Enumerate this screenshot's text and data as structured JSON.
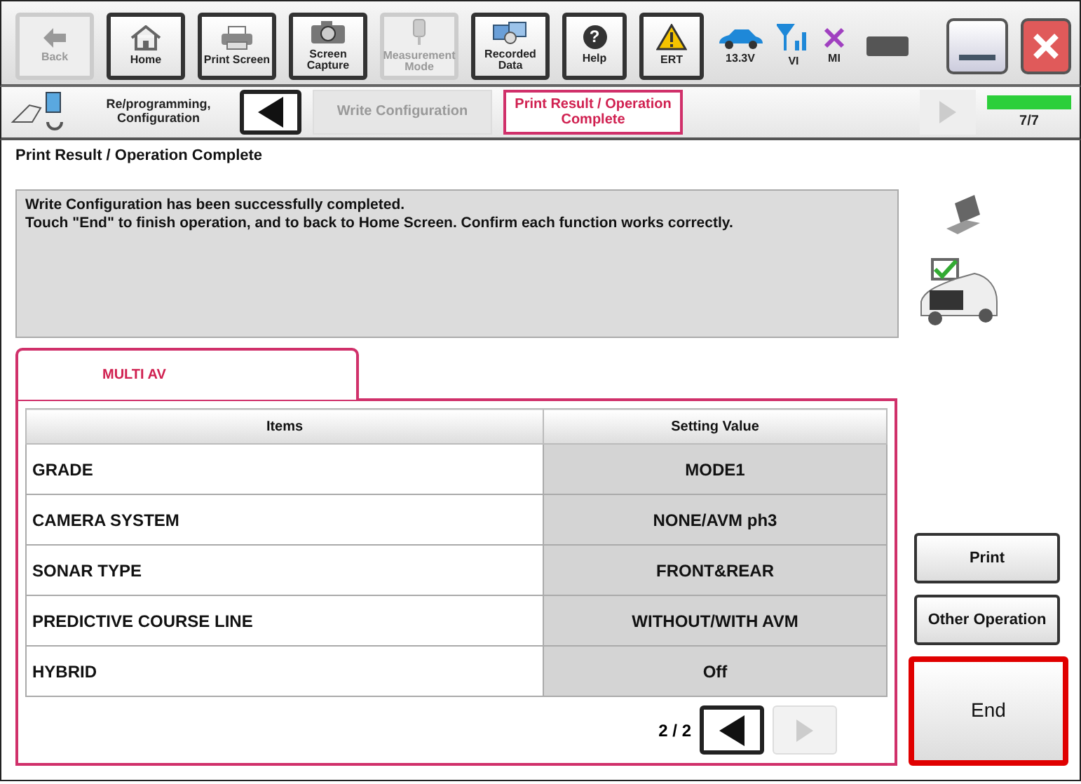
{
  "toolbar": [
    {
      "label": "Back",
      "disabled": true
    },
    {
      "label": "Home",
      "disabled": false
    },
    {
      "label": "Print Screen",
      "disabled": false
    },
    {
      "label": "Screen Capture",
      "disabled": false
    },
    {
      "label": "Measurement Mode",
      "disabled": true
    },
    {
      "label": "Recorded Data",
      "disabled": false
    },
    {
      "label": "Help",
      "disabled": false,
      "icon_text": "?"
    },
    {
      "label": "ERT",
      "disabled": false
    }
  ],
  "status": [
    {
      "label": "13.3V"
    },
    {
      "label": "VI"
    },
    {
      "label": "MI"
    }
  ],
  "breadcrumb": {
    "title": "Re/programming, Configuration",
    "steps": [
      {
        "label": "Write Configuration",
        "selected": false
      },
      {
        "label": "Print Result / Operation Complete",
        "selected": true
      }
    ],
    "progress": {
      "level": 1.0
    },
    "count": "7/7"
  },
  "page_title": "Print Result / Operation Complete",
  "message": [
    "Write Configuration has been successfully completed.",
    "Touch \"End\" to finish operation, and to back to Home Screen. Confirm each function works correctly."
  ],
  "tab": {
    "label": "MULTI AV",
    "selected": true
  },
  "table": {
    "columns": [
      "Items",
      "Setting Value"
    ],
    "rows": [
      [
        "GRADE",
        "MODE1"
      ],
      [
        "CAMERA SYSTEM",
        "NONE/AVM ph3"
      ],
      [
        "SONAR TYPE",
        "FRONT&REAR"
      ],
      [
        "PREDICTIVE COURSE LINE",
        "WITHOUT/WITH AVM"
      ],
      [
        "HYBRID",
        "Off"
      ]
    ]
  },
  "pager": {
    "label": "2 / 2",
    "prev_disabled": false,
    "next_disabled": true
  },
  "buttons": [
    {
      "label": "Print",
      "highlighted": false
    },
    {
      "label": "Other Operation",
      "highlighted": false
    },
    {
      "label": "End",
      "highlighted": true
    }
  ]
}
